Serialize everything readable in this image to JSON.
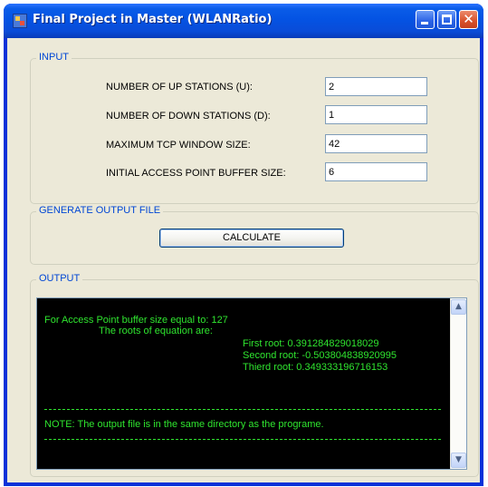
{
  "window": {
    "title": "Final Project in Master (WLANRatio)",
    "controls": {
      "minimize_icon": "minimize-icon",
      "maximize_icon": "maximize-icon",
      "close_icon": "close-icon",
      "close_glyph": "✕"
    }
  },
  "input_group": {
    "title": "INPUT",
    "fields": [
      {
        "label": "NUMBER OF UP STATIONS (U):",
        "value": "2"
      },
      {
        "label": "NUMBER OF DOWN STATIONS (D):",
        "value": "1"
      },
      {
        "label": "MAXIMUM TCP WINDOW SIZE:",
        "value": "42"
      },
      {
        "label": "INITIAL ACCESS POINT BUFFER SIZE:",
        "value": "6"
      }
    ]
  },
  "generate_group": {
    "title": "GENERATE OUTPUT FILE",
    "calculate_label": "CALCULATE"
  },
  "output_group": {
    "title": "OUTPUT",
    "lines": {
      "buffer": "For Access Point buffer size equal to: 127",
      "roots_header": "The roots of equation are:",
      "first_root": "First root: 0.391284829018029",
      "second_root": "Second root: -0.503804838920995",
      "third_root": "Thierd root: 0.349333196716153",
      "note": "NOTE: The output file is in the same directory as the programe."
    },
    "scroll": {
      "up_glyph": "▲",
      "down_glyph": "▼"
    }
  },
  "colors": {
    "titlebar": "#0453e3",
    "group_title": "#0046d5",
    "console_bg": "#000000",
    "console_text": "#2fe52f"
  }
}
